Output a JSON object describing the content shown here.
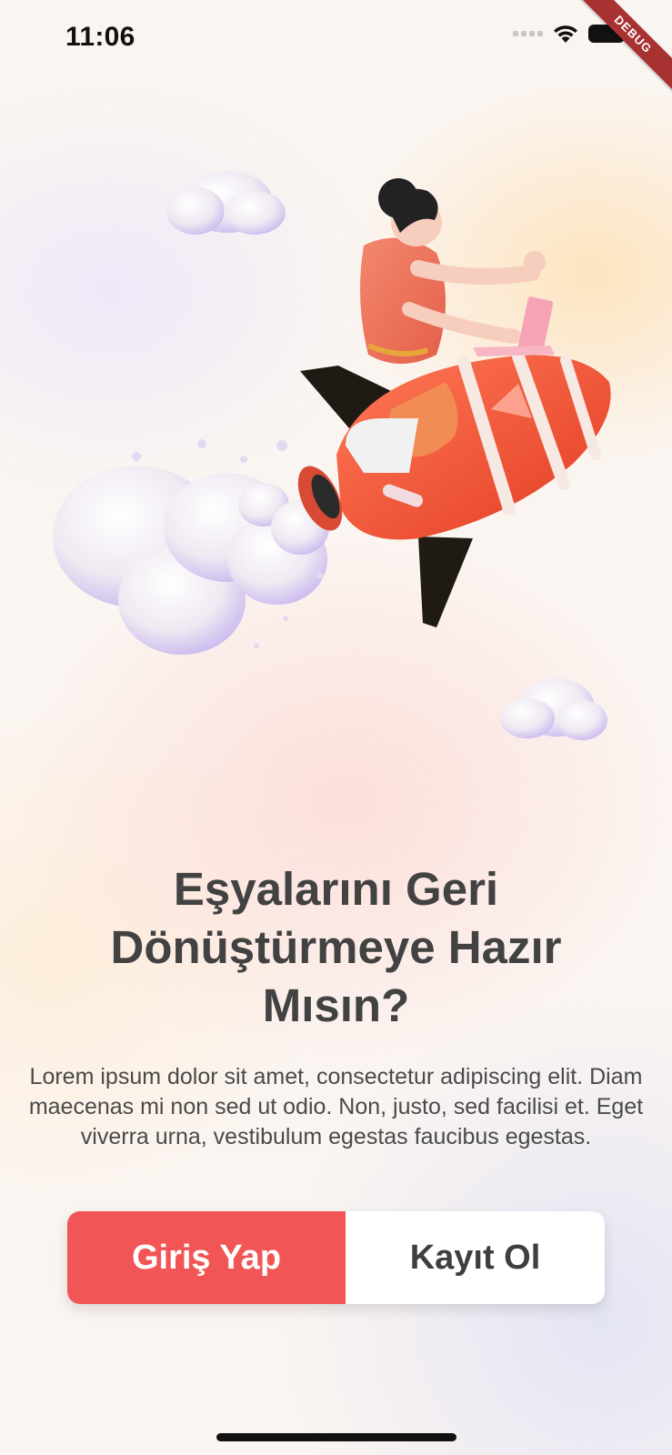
{
  "status_bar": {
    "time": "11:06",
    "debug_label": "DEBUG",
    "icons": [
      "cellular-signal-icon",
      "wifi-icon",
      "battery-icon"
    ]
  },
  "hero": {
    "icon": "rocket-girl-illustration",
    "description_icons": [
      "cloud-icon",
      "rocket-icon",
      "person-icon",
      "laptop-icon",
      "smoke-icon"
    ]
  },
  "onboarding": {
    "title": "Eşyalarını Geri Dönüştürmeye Hazır Mısın?",
    "description": "Lorem ipsum dolor sit amet, consectetur adipiscing elit. Diam maecenas mi non sed ut odio. Non, justo, sed facilisi et. Eget viverra urna, vestibulum egestas faucibus egestas."
  },
  "actions": {
    "login_label": "Giriş Yap",
    "register_label": "Kayıt Ol"
  },
  "colors": {
    "primary": "#f25555",
    "title_text": "#424242",
    "body_text": "#4a4a4a",
    "secondary_button_bg": "#ffffff",
    "debug_banner": "#a83232"
  }
}
